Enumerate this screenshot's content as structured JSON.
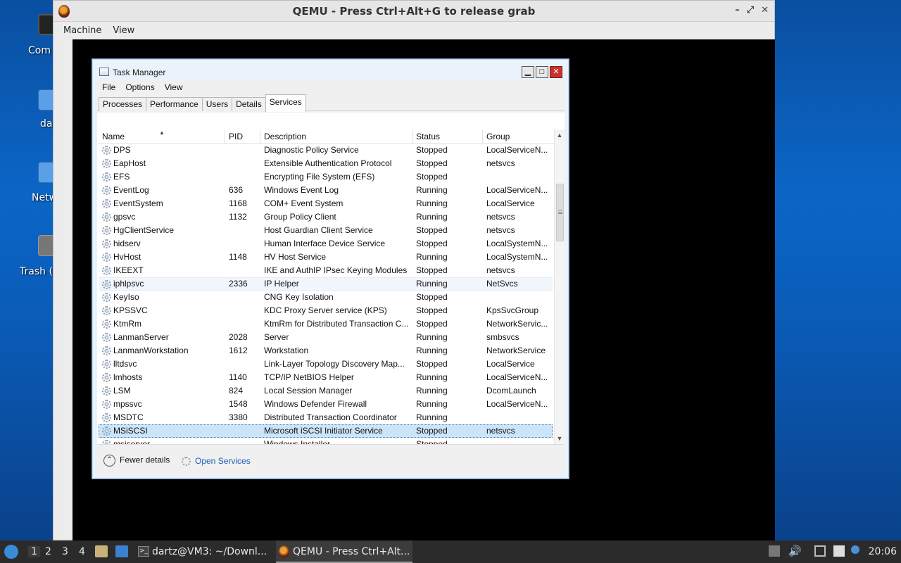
{
  "desktop": {
    "icons": [
      {
        "label": "Com",
        "icon": "computer-icon"
      },
      {
        "label": "da",
        "icon": "home-folder-icon"
      },
      {
        "label": "Netw",
        "icon": "network-icon"
      },
      {
        "label": "Trash (",
        "icon": "trash-icon"
      }
    ]
  },
  "qemu": {
    "title": "QEMU - Press Ctrl+Alt+G to release grab",
    "menu": [
      "Machine",
      "View"
    ],
    "controls": {
      "minimize": "–",
      "maximize": "⤢",
      "close": "✕"
    }
  },
  "taskmanager": {
    "title": "Task Manager",
    "menu": [
      "File",
      "Options",
      "View"
    ],
    "tabs": [
      "Processes",
      "Performance",
      "Users",
      "Details",
      "Services"
    ],
    "active_tab": "Services",
    "columns": {
      "name": "Name",
      "pid": "PID",
      "description": "Description",
      "status": "Status",
      "group": "Group"
    },
    "rows": [
      {
        "name": "DPS",
        "pid": "",
        "description": "Diagnostic Policy Service",
        "status": "Stopped",
        "group": "LocalServiceN..."
      },
      {
        "name": "EapHost",
        "pid": "",
        "description": "Extensible Authentication Protocol",
        "status": "Stopped",
        "group": "netsvcs"
      },
      {
        "name": "EFS",
        "pid": "",
        "description": "Encrypting File System (EFS)",
        "status": "Stopped",
        "group": ""
      },
      {
        "name": "EventLog",
        "pid": "636",
        "description": "Windows Event Log",
        "status": "Running",
        "group": "LocalServiceN..."
      },
      {
        "name": "EventSystem",
        "pid": "1168",
        "description": "COM+ Event System",
        "status": "Running",
        "group": "LocalService"
      },
      {
        "name": "gpsvc",
        "pid": "1132",
        "description": "Group Policy Client",
        "status": "Running",
        "group": "netsvcs"
      },
      {
        "name": "HgClientService",
        "pid": "",
        "description": "Host Guardian Client Service",
        "status": "Stopped",
        "group": "netsvcs"
      },
      {
        "name": "hidserv",
        "pid": "",
        "description": "Human Interface Device Service",
        "status": "Stopped",
        "group": "LocalSystemN..."
      },
      {
        "name": "HvHost",
        "pid": "1148",
        "description": "HV Host Service",
        "status": "Running",
        "group": "LocalSystemN..."
      },
      {
        "name": "IKEEXT",
        "pid": "",
        "description": "IKE and AuthIP IPsec Keying Modules",
        "status": "Stopped",
        "group": "netsvcs"
      },
      {
        "name": "iphlpsvc",
        "pid": "2336",
        "description": "IP Helper",
        "status": "Running",
        "group": "NetSvcs"
      },
      {
        "name": "KeyIso",
        "pid": "",
        "description": "CNG Key Isolation",
        "status": "Stopped",
        "group": ""
      },
      {
        "name": "KPSSVC",
        "pid": "",
        "description": "KDC Proxy Server service (KPS)",
        "status": "Stopped",
        "group": "KpsSvcGroup"
      },
      {
        "name": "KtmRm",
        "pid": "",
        "description": "KtmRm for Distributed Transaction C...",
        "status": "Stopped",
        "group": "NetworkServic..."
      },
      {
        "name": "LanmanServer",
        "pid": "2028",
        "description": "Server",
        "status": "Running",
        "group": "smbsvcs"
      },
      {
        "name": "LanmanWorkstation",
        "pid": "1612",
        "description": "Workstation",
        "status": "Running",
        "group": "NetworkService"
      },
      {
        "name": "lltdsvc",
        "pid": "",
        "description": "Link-Layer Topology Discovery Map...",
        "status": "Stopped",
        "group": "LocalService"
      },
      {
        "name": "lmhosts",
        "pid": "1140",
        "description": "TCP/IP NetBIOS Helper",
        "status": "Running",
        "group": "LocalServiceN..."
      },
      {
        "name": "LSM",
        "pid": "824",
        "description": "Local Session Manager",
        "status": "Running",
        "group": "DcomLaunch"
      },
      {
        "name": "mpssvc",
        "pid": "1548",
        "description": "Windows Defender Firewall",
        "status": "Running",
        "group": "LocalServiceN..."
      },
      {
        "name": "MSDTC",
        "pid": "3380",
        "description": "Distributed Transaction Coordinator",
        "status": "Running",
        "group": ""
      },
      {
        "name": "MSiSCSI",
        "pid": "",
        "description": "Microsoft iSCSI Initiator Service",
        "status": "Stopped",
        "group": "netsvcs"
      },
      {
        "name": "msiserver",
        "pid": "",
        "description": "Windows Installer",
        "status": "Stopped",
        "group": ""
      }
    ],
    "hover_row": "iphlpsvc",
    "selected_row": "MSiSCSI",
    "footer": {
      "fewer_details": "Fewer details",
      "open_services": "Open Services"
    }
  },
  "taskbar": {
    "workspaces": [
      "1",
      "2",
      "3",
      "4"
    ],
    "tasks": [
      {
        "label": "dartz@VM3: ~/Downl...",
        "icon": "terminal-icon"
      },
      {
        "label": "QEMU - Press Ctrl+Alt...",
        "icon": "qemu-icon"
      }
    ],
    "clock": "20:06"
  }
}
